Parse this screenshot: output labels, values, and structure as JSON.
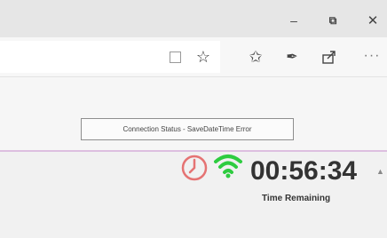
{
  "window": {
    "minimize_glyph": "–",
    "maximize_glyph": "⧉",
    "close_glyph": "✕"
  },
  "toolbar": {
    "icons": [
      "reading-view-icon",
      "star-icon",
      "favorites-icon",
      "pen-icon",
      "share-icon",
      "more-icon"
    ],
    "star_glyph": "☆",
    "favorites_glyph": "✩",
    "pen_glyph": "✒",
    "more_glyph": "···"
  },
  "tooltip": {
    "text": "Connection Status - SaveDateTime Error"
  },
  "status": {
    "timer": "00:56:34",
    "timer_label": "Time Remaining",
    "clock_color": "#e57373",
    "wifi_color": "#2ecc40"
  }
}
